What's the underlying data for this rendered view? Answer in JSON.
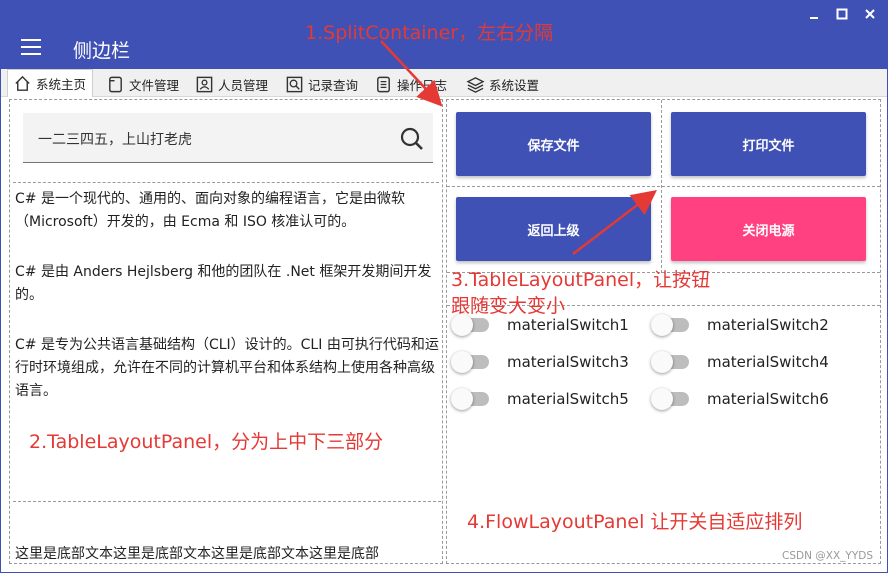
{
  "window": {
    "title": "侧边栏",
    "controls": [
      "minimize",
      "maximize",
      "close"
    ]
  },
  "tabs": [
    {
      "label": "系统主页",
      "icon": "home-icon",
      "active": true
    },
    {
      "label": "文件管理",
      "icon": "file-icon",
      "active": false
    },
    {
      "label": "人员管理",
      "icon": "user-icon",
      "active": false
    },
    {
      "label": "记录查询",
      "icon": "search-icon",
      "active": false
    },
    {
      "label": "操作日志",
      "icon": "list-icon",
      "active": false
    },
    {
      "label": "系统设置",
      "icon": "layers-icon",
      "active": false
    }
  ],
  "search": {
    "value": "一二三四五，上山打老虎",
    "icon": "search-icon"
  },
  "paragraphs": [
    "C# 是一个现代的、通用的、面向对象的编程语言，它是由微软（Microsoft）开发的，由 Ecma 和 ISO 核准认可的。",
    "C# 是由 Anders Hejlsberg 和他的团队在 .Net 框架开发期间开发的。",
    "C# 是专为公共语言基础结构（CLI）设计的。CLI 由可执行代码和运行时环境组成，允许在不同的计算机平台和体系结构上使用各种高级语言。"
  ],
  "bottom_text": "这里是底部文本这里是底部文本这里是底部文本这里是底部",
  "buttons": {
    "save": "保存文件",
    "print": "打印文件",
    "back": "返回上级",
    "power": "关闭电源"
  },
  "switches": [
    {
      "label": "materialSwitch1",
      "on": false
    },
    {
      "label": "materialSwitch2",
      "on": false
    },
    {
      "label": "materialSwitch3",
      "on": false
    },
    {
      "label": "materialSwitch4",
      "on": false
    },
    {
      "label": "materialSwitch5",
      "on": false
    },
    {
      "label": "materialSwitch6",
      "on": false
    }
  ],
  "annotations": {
    "a1": "1.SplitContainer，左右分隔",
    "a2": "2.TableLayoutPanel，分为上中下三部分",
    "a3_line1": "3.TableLayoutPanel，让按钮",
    "a3_line2": "跟随变大变小",
    "a4": "4.FlowLayoutPanel 让开关自适应排列"
  },
  "watermark": "CSDN @XX_YYDS",
  "colors": {
    "primary": "#3f51b5",
    "accent": "#ff4081",
    "annotation": "#e53935"
  }
}
